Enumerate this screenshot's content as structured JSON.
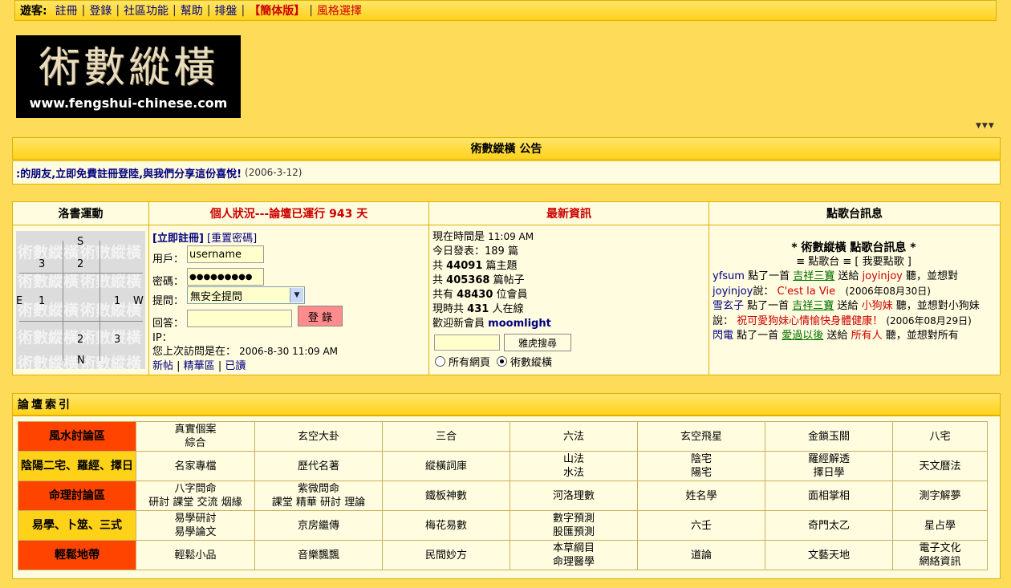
{
  "topbar": {
    "guest_label": "遊客:",
    "links": [
      "註冊",
      "登錄",
      "社區功能",
      "幫助",
      "排盤"
    ],
    "simplified": "【簡体版】",
    "style": "風格選擇"
  },
  "logo": {
    "title": "術數縱橫",
    "url": "www.fengshui-chinese.com"
  },
  "announcement": {
    "header": "術數縱橫 公告",
    "text": ":的朋友,立即免費註冊登陸,與我們分享這份喜悅!",
    "date": "(2006-3-12)"
  },
  "panels": {
    "luoshu": {
      "header": "洛書運動",
      "labels": {
        "S": "S",
        "N": "N",
        "E": "E",
        "W": "W"
      },
      "numbers": [
        "3",
        "2",
        "1",
        "1",
        "2",
        "3"
      ],
      "watermark": "術數縱橫"
    },
    "status": {
      "header": "個人狀況---論壇已運行 943 天",
      "register": "[立即註冊]",
      "reset": "[重置密碼]",
      "user_label": "用戶：",
      "user_value": "username",
      "pass_label": "密碼：",
      "pass_value": "●●●●●●●●●",
      "question_label": "提問：",
      "question_value": "無安全提問",
      "answer_label": "回答：",
      "login_button": "登 錄",
      "ip_label": "IP：",
      "last_visit_label": "您上次訪問是在：",
      "last_visit_value": "2006-8-30 11:09 AM",
      "links": [
        "新帖",
        "精華區",
        "已讀"
      ]
    },
    "news": {
      "header": "最新資訊",
      "time_label": "現在時間是",
      "time_value": "11:09 AM",
      "today_label": "今日發表：",
      "today_value": "189 篇",
      "topics_pre": "共",
      "topics_value": "44091",
      "topics_post": "篇主題",
      "posts_pre": "共",
      "posts_value": "405368",
      "posts_post": "篇帖子",
      "members_pre": "共有",
      "members_value": "48430",
      "members_post": "位會員",
      "online_pre": "現時共",
      "online_value": "431",
      "online_post": "人在線",
      "welcome_label": "歡迎新會員",
      "welcome_value": "moomlight",
      "search_button": "雅虎搜尋",
      "radio_all": "所有網頁",
      "radio_site": "術數縱橫"
    },
    "songs": {
      "header": "點歌台訊息",
      "title": "* 術數縱橫 點歌台訊息 *",
      "sub": "≡ 點歌台 ≡ [ 我要點歌 ]",
      "e1_user": "yfsum",
      "e1_a": " 點了一首 ",
      "e1_song": "吉祥三寶",
      "e1_b": " 送給 ",
      "e1_to": "joyinjoy",
      "e1_c": " 聽，並想對",
      "e1_to2": "joyinjoy",
      "e1_d": "說：",
      "e1_msg": "C'est la Vie",
      "e1_date": "(2006年08月30日)",
      "e2_user": "雪玄子",
      "e2_a": " 點了一首 ",
      "e2_song": "吉祥三寶",
      "e2_b": " 送給 ",
      "e2_to": "小狗妹",
      "e2_c": " 聽，並想對小",
      "e2_d": "狗妹說：",
      "e2_msg": "祝可愛狗妹心情愉快身體健康！",
      "e2_date": "(2006年08月29日)",
      "e3_user": "閃電",
      "e3_a": " 點了一首 ",
      "e3_song": "愛過以後",
      "e3_b": " 送給 ",
      "e3_to": "所有人",
      "e3_c": " 聽，並想對所有"
    }
  },
  "index": {
    "header": "論壇索引",
    "rows": [
      {
        "cat": "風水討論區",
        "cells": [
          [
            "真實個案",
            "綜合"
          ],
          [
            "玄空大卦"
          ],
          [
            "三合"
          ],
          [
            "六法"
          ],
          [
            "玄空飛星"
          ],
          [
            "金鎖玉關"
          ],
          [
            "八宅"
          ]
        ]
      },
      {
        "cat": "陰陽二宅、羅經、擇日",
        "cells": [
          [
            "名家專檔"
          ],
          [
            "歷代名著"
          ],
          [
            "縱橫詞庫"
          ],
          [
            "山法",
            "水法"
          ],
          [
            "陰宅",
            "陽宅"
          ],
          [
            "羅經解透",
            "擇日學"
          ],
          [
            "天文曆法"
          ]
        ]
      },
      {
        "cat": "命理討論區",
        "cells": [
          [
            "八字問命",
            "研討 課堂 交流 烟緣"
          ],
          [
            "紫微問命",
            "課堂 精華 研討 理論"
          ],
          [
            "鐵板神數"
          ],
          [
            "河洛理數"
          ],
          [
            "姓名學"
          ],
          [
            "面相掌相"
          ],
          [
            "測字解夢"
          ]
        ]
      },
      {
        "cat": "易學、卜筮、三式",
        "cells": [
          [
            "易學研討",
            "易學論文"
          ],
          [
            "京房繼傳"
          ],
          [
            "梅花易數"
          ],
          [
            "數字預測",
            "股匯預測"
          ],
          [
            "六壬"
          ],
          [
            "奇門太乙"
          ],
          [
            "星占學"
          ]
        ]
      },
      {
        "cat": "輕鬆地帶",
        "cells": [
          [
            "輕鬆小品"
          ],
          [
            "音樂飄飄"
          ],
          [
            "民間妙方"
          ],
          [
            "本草綱目",
            "命理醫學"
          ],
          [
            "道論"
          ],
          [
            "文藝天地"
          ],
          [
            "電子文化",
            "網絡資訊"
          ]
        ]
      }
    ]
  },
  "colors": {
    "background": "#FFDB5A",
    "category_red": "#FF4400",
    "category_yellow": "#FFD21A",
    "link": "#000080",
    "alert": "#CC0000"
  }
}
